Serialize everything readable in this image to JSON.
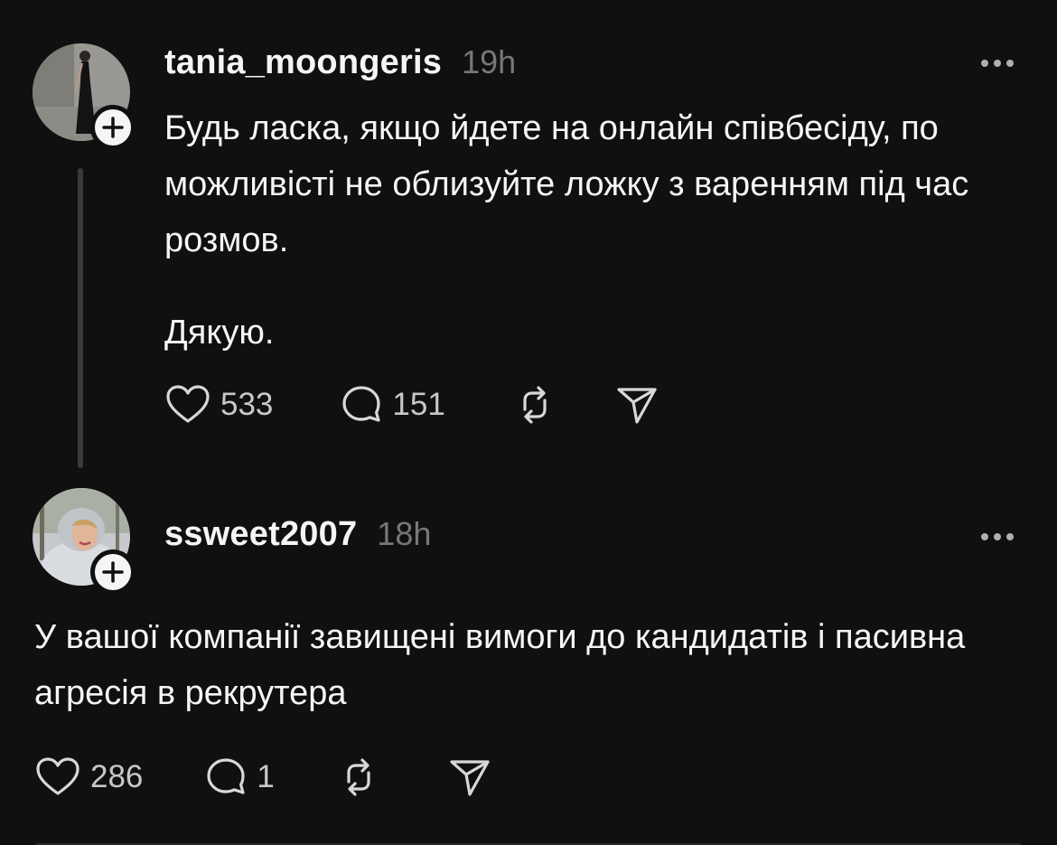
{
  "posts": [
    {
      "username": "tania_moongeris",
      "time": "19h",
      "paragraphs": [
        "Будь ласка, якщо йдете на онлайн співбесіду, по можливісті не облизуйте ложку з варенням під час розмов.",
        "Дякую."
      ],
      "likes": "533",
      "replies": "151"
    },
    {
      "username": "ssweet2007",
      "time": "18h",
      "paragraphs": [
        "У вашої компанії завищені вимоги до кандидатів і пасивна агресія в рекрутера"
      ],
      "likes": "286",
      "replies": "1"
    }
  ],
  "icons": {
    "like": "heart-icon",
    "reply": "comment-bubble-icon",
    "repost": "repost-icon",
    "share": "send-icon",
    "more": "more-dots-icon",
    "follow": "plus-icon"
  },
  "colors": {
    "background": "#101010",
    "text": "#f3f5f7",
    "muted": "#777777"
  }
}
